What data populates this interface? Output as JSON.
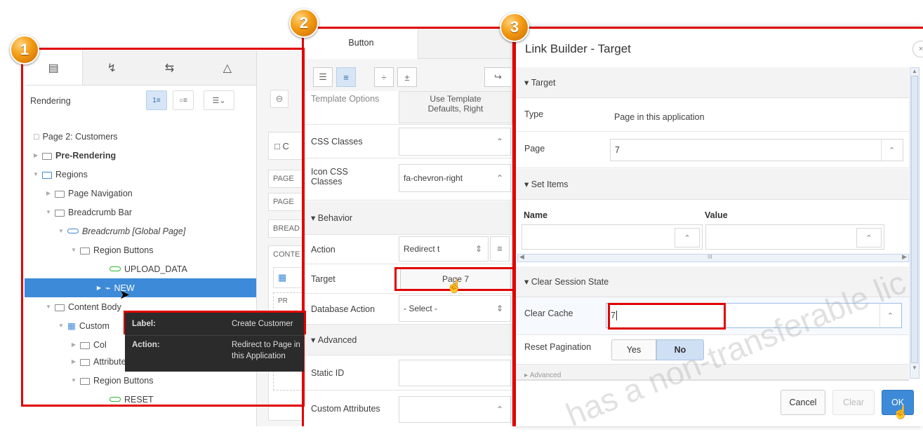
{
  "badges": [
    "1",
    "2",
    "3"
  ],
  "panel1": {
    "rendering_label": "Rendering",
    "tree": {
      "page": "Page 2: Customers",
      "pre_rendering": "Pre-Rendering",
      "regions": "Regions",
      "page_navigation": "Page Navigation",
      "breadcrumb_bar": "Breadcrumb Bar",
      "breadcrumb": "Breadcrumb [Global Page]",
      "region_buttons": "Region Buttons",
      "upload_data": "UPLOAD_DATA",
      "new": "NEW",
      "content_body": "Content Body",
      "customers": "Custom",
      "columns": "Col",
      "attributes": "Attributes",
      "region_buttons2": "Region Buttons",
      "reset": "RESET"
    },
    "tooltip": {
      "label_key": "Label:",
      "label_val": "Create Customer",
      "action_key": "Action:",
      "action_val_1": "Redirect to Page in",
      "action_val_2": "this Application"
    },
    "middle": {
      "title": "C",
      "items": [
        "PAGE",
        "PAGE",
        "BREAD",
        "CONTE"
      ],
      "pr": "PR"
    }
  },
  "panel2": {
    "tab": "Button",
    "template_options_label": "Template Options",
    "template_options_value_1": "Use Template",
    "template_options_value_2": "Defaults, Right",
    "css_classes_label": "CSS Classes",
    "css_classes_value": "",
    "icon_css_label_1": "Icon CSS",
    "icon_css_label_2": "Classes",
    "icon_css_value": "fa-chevron-right",
    "behavior": "Behavior",
    "action_label": "Action",
    "action_value": "Redirect t",
    "target_label": "Target",
    "target_value": "Page 7",
    "db_action_label": "Database Action",
    "db_action_value": "- Select -",
    "advanced": "Advanced",
    "static_id_label": "Static ID",
    "custom_attr_label": "Custom Attributes"
  },
  "panel3": {
    "title": "Link Builder - Target",
    "target_section": "Target",
    "type_label": "Type",
    "type_value": "Page in this application",
    "page_label": "Page",
    "page_value": "7",
    "set_items_section": "Set Items",
    "name_header": "Name",
    "value_header": "Value",
    "clear_session_section": "Clear Session State",
    "clear_cache_label": "Clear Cache",
    "clear_cache_value": "7",
    "reset_pagination_label": "Reset Pagination",
    "yes": "Yes",
    "no": "No",
    "advanced": "Advanced",
    "cancel": "Cancel",
    "clear": "Clear",
    "ok": "OK",
    "scroll_mark": "III"
  },
  "watermark": "has a non-transferable lic",
  "colors": {
    "accent": "#3d8ad8",
    "highlight": "#e00000",
    "badge": "#f39a12"
  }
}
